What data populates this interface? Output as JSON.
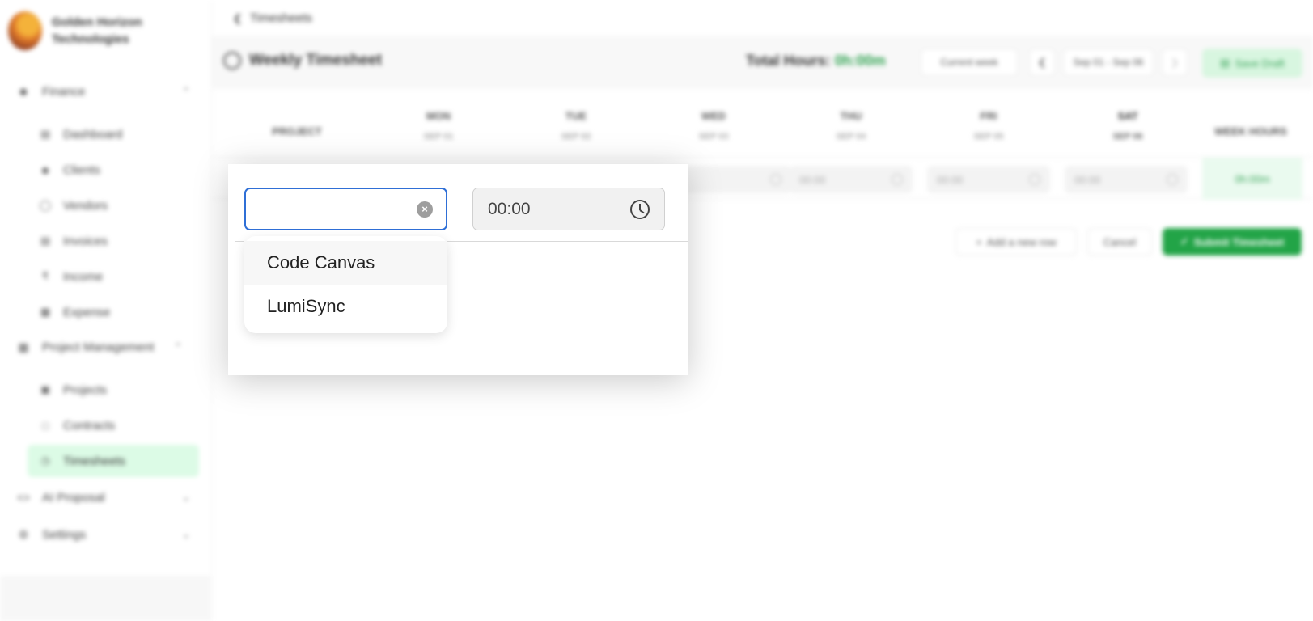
{
  "brand": {
    "name": "Golden Horizon Technologies"
  },
  "breadcrumb": {
    "label": "Timesheets"
  },
  "sidebar": {
    "groups": [
      {
        "label": "Finance"
      },
      {
        "label": "Project Management"
      },
      {
        "label": "AI Proposal"
      },
      {
        "label": "Settings"
      }
    ],
    "items": [
      {
        "label": "Dashboard"
      },
      {
        "label": "Clients"
      },
      {
        "label": "Vendors"
      },
      {
        "label": "Invoices"
      },
      {
        "label": "Income"
      },
      {
        "label": "Expense"
      },
      {
        "label": "Projects"
      },
      {
        "label": "Contracts"
      },
      {
        "label": "Timesheets"
      }
    ]
  },
  "toolbar": {
    "title": "Weekly Timesheet",
    "total_label": "Total Hours:",
    "total_value": "0h:00m",
    "current_week": "Current week",
    "date_range": "Sep 01 - Sep 06",
    "save_draft": "Save Draft"
  },
  "grid": {
    "project_header": "PROJECT",
    "week_hours_header": "WEEK HOURS",
    "days": [
      {
        "day": "MON",
        "date": "SEP 01"
      },
      {
        "day": "TUE",
        "date": "SEP 02"
      },
      {
        "day": "WED",
        "date": "SEP 03"
      },
      {
        "day": "THU",
        "date": "SEP 04"
      },
      {
        "day": "FRI",
        "date": "SEP 05"
      },
      {
        "day": "SAT",
        "date": "SEP 06"
      }
    ],
    "row": {
      "cells": [
        "00:00",
        "00:00",
        "00:00"
      ],
      "week_hours": "0h:00m"
    }
  },
  "actions": {
    "add_row": "Add a new row",
    "cancel": "Cancel",
    "submit": "Submit Timesheet"
  },
  "popup": {
    "project_input_value": "",
    "time_value": "00:00",
    "options": [
      "Code Canvas",
      "LumiSync"
    ]
  },
  "colors": {
    "accent_green": "#22a447",
    "focus_blue": "#2f6fd6",
    "active_nav_bg": "#dcfbe6"
  }
}
